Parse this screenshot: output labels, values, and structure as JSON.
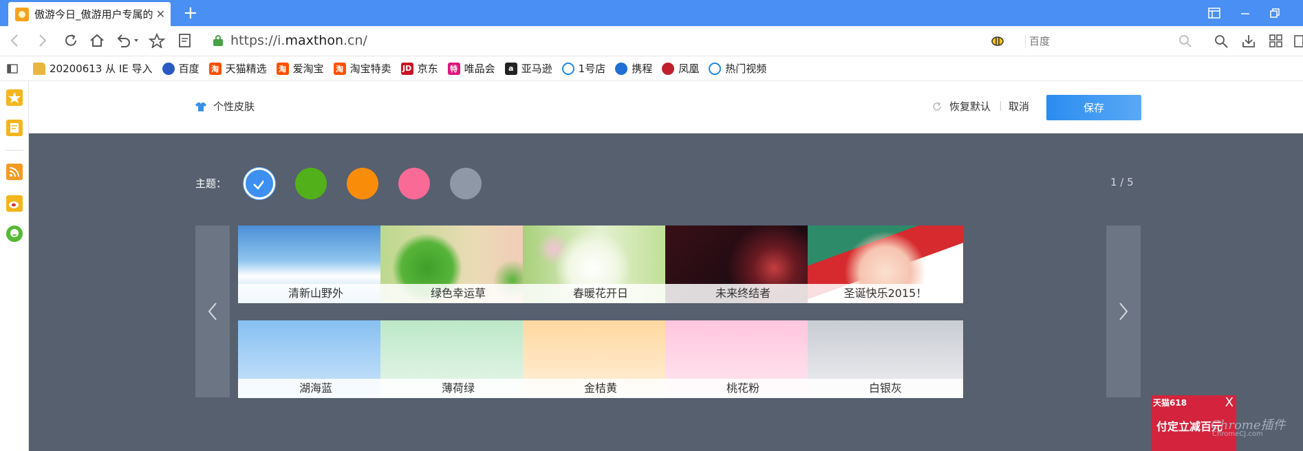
{
  "tab": {
    "title": "傲游今日_傲游用户专属的",
    "close": "✕"
  },
  "titlebar": {
    "new_tab": "+"
  },
  "address": {
    "prefix": "https://i.",
    "domain": "maxthon",
    "suffix": ".cn/"
  },
  "search": {
    "placeholder": "百度"
  },
  "bookmarks": [
    {
      "label": "20200613 从 IE 导入",
      "icon": "folder-icon",
      "color": "#e9b640"
    },
    {
      "label": "百度",
      "icon": "baidu-icon",
      "color": "#2b59c3"
    },
    {
      "label": "天猫精选",
      "icon": "taobao-icon",
      "color": "#ff5000"
    },
    {
      "label": "爱淘宝",
      "icon": "taobao-icon",
      "color": "#ff5000"
    },
    {
      "label": "淘宝特卖",
      "icon": "taobao-icon",
      "color": "#ff5000"
    },
    {
      "label": "京东",
      "icon": "jd-icon",
      "color": "#c81623"
    },
    {
      "label": "唯品会",
      "icon": "vip-icon",
      "color": "#e0157d"
    },
    {
      "label": "亚马逊",
      "icon": "amazon-icon",
      "color": "#222222"
    },
    {
      "label": "1号店",
      "icon": "ie-icon",
      "color": "#1e88e5"
    },
    {
      "label": "携程",
      "icon": "ctrip-icon",
      "color": "#1f6fd6"
    },
    {
      "label": "凤凰",
      "icon": "ifeng-icon",
      "color": "#c0202b"
    },
    {
      "label": "热门视频",
      "icon": "ie-icon",
      "color": "#1e88e5"
    }
  ],
  "bookmark_icon_text": {
    "jd": "JD",
    "vip": "特",
    "taobao": "淘",
    "amazon": "a"
  },
  "skin": {
    "title": "个性皮肤",
    "restore": "恢复默认",
    "separator": "|",
    "cancel": "取消",
    "save": "保存",
    "theme_label": "主题：",
    "pager": "1 / 5",
    "themes": [
      {
        "color": "#3d8ff0",
        "selected": true
      },
      {
        "color": "#52b01a",
        "selected": false
      },
      {
        "color": "#f98d0a",
        "selected": false
      },
      {
        "color": "#f96a96",
        "selected": false
      },
      {
        "color": "#8f98a6",
        "selected": false
      }
    ],
    "items": [
      {
        "label": "清新山野外"
      },
      {
        "label": "绿色幸运草"
      },
      {
        "label": "春暖花开日"
      },
      {
        "label": "未来终结者"
      },
      {
        "label": "圣诞快乐2015！"
      },
      {
        "label": "湖海蓝"
      },
      {
        "label": "薄荷绿"
      },
      {
        "label": "金桔黄"
      },
      {
        "label": "桃花粉"
      },
      {
        "label": "白银灰"
      }
    ]
  },
  "ad": {
    "brand": "天猫618",
    "headline": "付定立减百元",
    "close": "X"
  },
  "watermark": {
    "line1": "Chrome插件",
    "line2": "ChromeCJ.com"
  }
}
